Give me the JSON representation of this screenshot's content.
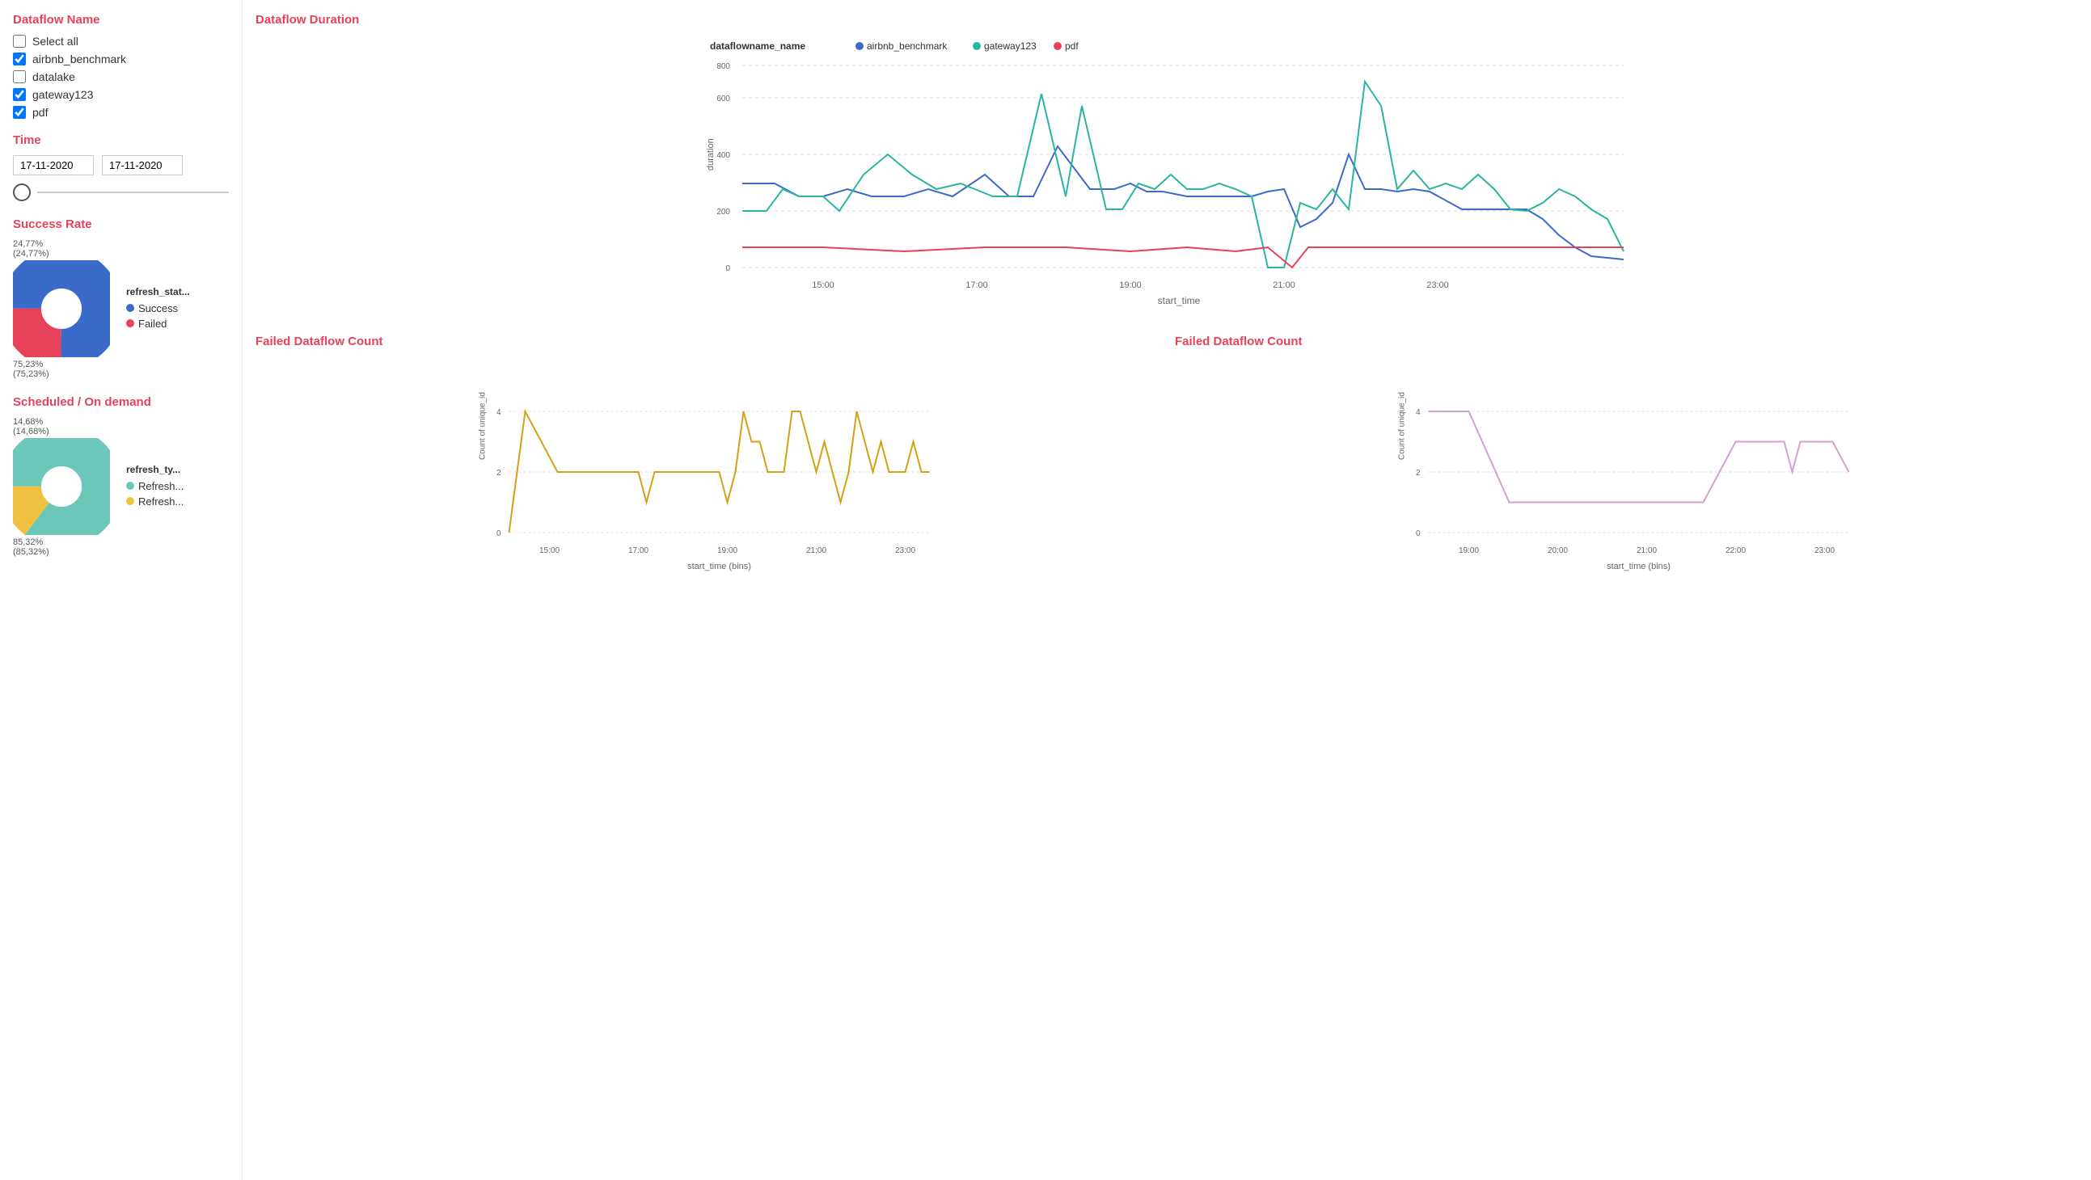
{
  "sidebar": {
    "dataflow_name_title": "Dataflow Name",
    "select_all_label": "Select all",
    "checkboxes": [
      {
        "id": "airbnb",
        "label": "airbnb_benchmark",
        "checked": true
      },
      {
        "id": "datalake",
        "label": "datalake",
        "checked": false
      },
      {
        "id": "gateway",
        "label": "gateway123",
        "checked": true
      },
      {
        "id": "pdf",
        "label": "pdf",
        "checked": true
      }
    ],
    "time_title": "Time",
    "date_start": "17-11-2020",
    "date_end": "17-11-2020"
  },
  "duration_chart": {
    "title": "Dataflow Duration",
    "legend_label": "dataflowname_name",
    "series": [
      {
        "name": "airbnb_benchmark",
        "color": "#3b6bca"
      },
      {
        "name": "gateway123",
        "color": "#2ab5a0"
      },
      {
        "name": "pdf",
        "color": "#e8425a"
      }
    ],
    "y_label": "duration",
    "x_label": "start_time",
    "y_ticks": [
      "0",
      "200",
      "400",
      "600",
      "800"
    ],
    "x_ticks": [
      "15:00",
      "17:00",
      "19:00",
      "21:00",
      "23:00"
    ]
  },
  "success_rate": {
    "title": "Success Rate",
    "legend_title": "refresh_stat...",
    "segments": [
      {
        "label": "Success",
        "color": "#3b6bca",
        "value": 75.23,
        "pct_text": "75,23%",
        "sub_text": "(75,23%)"
      },
      {
        "label": "Failed",
        "color": "#e8425a",
        "value": 24.77,
        "pct_text": "24,77%",
        "sub_text": "(24,77%)"
      }
    ]
  },
  "scheduled": {
    "title": "Scheduled / On demand",
    "legend_title": "refresh_ty...",
    "segments": [
      {
        "label": "Refresh...",
        "color": "#6dc7b8",
        "value": 85.32,
        "pct_text": "85,32%",
        "sub_text": "(85,32%)"
      },
      {
        "label": "Refresh...",
        "color": "#f0c040",
        "value": 14.68,
        "pct_text": "14,68%",
        "sub_text": "(14,68%)"
      }
    ]
  },
  "failed_count_top": {
    "title": "Failed Dataflow Count",
    "y_label": "Count of unique_id",
    "x_label": "start_time (bins)",
    "y_ticks": [
      "0",
      "2",
      "4"
    ],
    "x_ticks": [
      "15:00",
      "17:00",
      "19:00",
      "21:00",
      "23:00"
    ],
    "color": "#d4a017"
  },
  "failed_count_bottom": {
    "title": "Failed Dataflow Count",
    "y_label": "Count of unique_id",
    "x_label": "start_time (bins)",
    "y_ticks": [
      "0",
      "2",
      "4"
    ],
    "x_ticks": [
      "19:00",
      "20:00",
      "21:00",
      "22:00",
      "23:00"
    ],
    "color": "#d4a0d0"
  }
}
